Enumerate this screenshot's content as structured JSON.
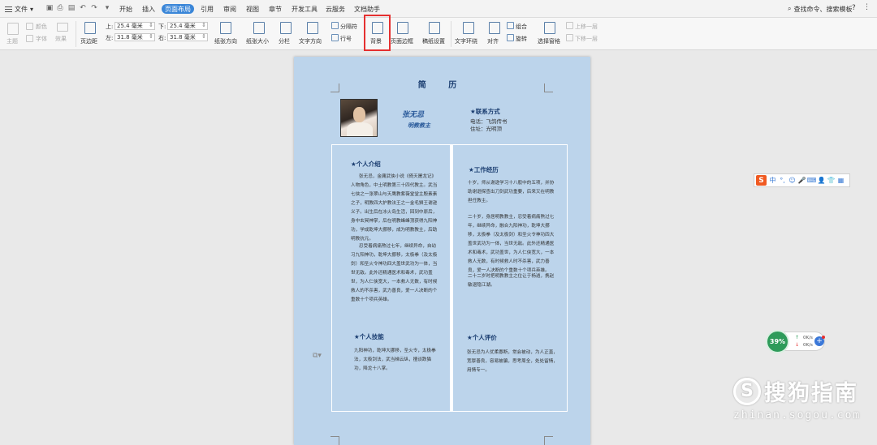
{
  "menubar": {
    "file_label": "文件",
    "tabs": [
      "开始",
      "插入",
      "页面布局",
      "引用",
      "审阅",
      "视图",
      "章节",
      "开发工具",
      "云服务",
      "文档助手"
    ],
    "active_tab": "页面布局",
    "search_label": "查找命令、搜索模板",
    "help_glyph": "?",
    "more_glyph": "⋮"
  },
  "ribbon": {
    "theme_label": "主题",
    "colors_label": "颜色",
    "fonts_label": "字体",
    "effects_label": "效果",
    "margins_label": "页边距",
    "top_label": "上:",
    "top_value": "25.4 毫米",
    "bottom_label": "下:",
    "bottom_value": "25.4 毫米",
    "left_label": "左:",
    "left_value": "31.8 毫米",
    "right_label": "右:",
    "right_value": "31.8 毫米",
    "orientation_label": "纸张方向",
    "size_label": "纸张大小",
    "columns_label": "分栏",
    "direction_label": "文字方向",
    "breaks_label": "分隔符",
    "line_numbers_label": "行号",
    "background_label": "背景",
    "page_border_label": "页面边框",
    "draft_label": "稿纸设置",
    "wrap_label": "文字环绕",
    "align_label": "对齐",
    "group_label": "组合",
    "rotate_label": "旋转",
    "select_pane_label": "选择窗格",
    "bring_forward_label": "上移一层",
    "send_backward_label": "下移一层"
  },
  "resume": {
    "title": "简 历",
    "name": "张无忌",
    "role": "明教教主",
    "contact_heading": "★联系方式",
    "phone": "电话：飞鸽传书",
    "address": "住址：光明顶",
    "intro_heading": "★个人介绍",
    "intro_p1": "张无忌，金庸武侠小说《倚天屠龙记》人物角色，中土明教第三十四代教主。武当七侠之一张翠山与天鹰教紫薇堂堂主殷素素之子，明教四大护教法王之一金毛狮王谢逊义子。出生后在冰火岛生活，回到中原后，身中玄冥神掌，后在明教峰峰顶获得九阳神功，学成乾坤大挪移，成为明教教主，后助明教抗元。",
    "intro_p2": "忍受着病痛熬过七年，继续异命，自幼习九阳神功，乾坤大挪移，太极拳（及太极剑）和圣火令神功四大盖世武功为一体，当世无敌。此外还精通医术和毒术，武功盖世，为人仁侠宽大，一本救人无数，有时候救人的不杀害，武力善良，爱一人决断的个重数十个项兵英雄。",
    "skills_heading": "★个人技能",
    "skills_p": "九阳神功，乾坤大挪移，圣火令，太极拳法，太极剑法，武当梯云纵，擅谈跌猫功，降龙十八掌。",
    "work_heading": "★工作经历",
    "work_p1": "十岁，师从谢逊学习十八般中的五项，并协助谢逊探查出刀剑武功重要，后来又在明教担任教主。",
    "work_p2": "二十岁，身居明教教主，忍受着病痛熬过七年，继续异命，融合九阳神功，乾坤大挪移，太极拳（及太极剑）和圣火令神功四大盖世武功为一体，当世无敌。此外还精通医术和毒术，武功盖世，为人仁侠宽大，一本救人无数，有时候救人时不杀害，武力善良，爱一人决断的个重数十个项兵英雄。",
    "work_p3": "二十二岁时把明教教主之位让于杨逍，携赵敏退隐江湖。",
    "eval_heading": "★个人评价",
    "eval_p": "张无忌为人优柔寡断，常会被动，为人正直，宽厚善良，容易被骗，思考周全，处处留情，用情专一。"
  },
  "ime": {
    "logo": "S",
    "glyphs": [
      "中",
      "°,",
      "☺",
      "🎤",
      "⌨",
      "👤",
      "👕",
      "▦"
    ]
  },
  "net_monitor": {
    "percent": "39%",
    "up": "0K/s",
    "down": "0K/s",
    "up_arrow": "↑",
    "down_arrow": "↓",
    "plus": "+"
  },
  "watermark": {
    "text": "搜狗指南",
    "url": "zhinan.sogou.com"
  },
  "colors": {
    "page_bg": "#bcd4eb",
    "accent_tab": "#3a86d8",
    "highlight": "#e53030"
  }
}
